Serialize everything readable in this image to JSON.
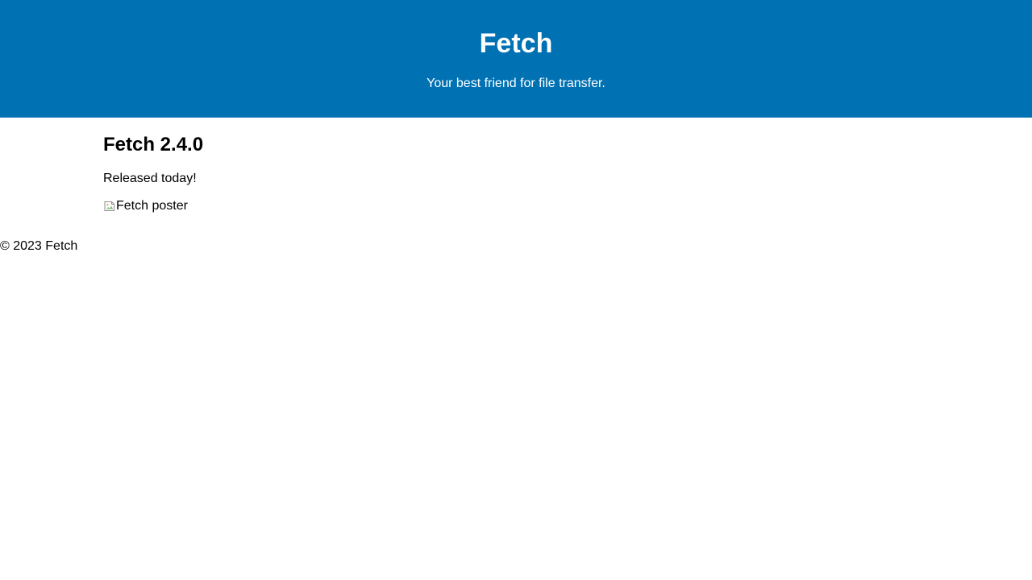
{
  "header": {
    "title": "Fetch",
    "tagline": "Your best friend for file transfer.",
    "background_color": "#0071b3"
  },
  "main": {
    "release_title": "Fetch 2.4.0",
    "release_note": "Released today!",
    "poster": {
      "alt": "Fetch poster",
      "icon": "broken-image-icon"
    }
  },
  "footer": {
    "text": "© 2023 Fetch"
  }
}
